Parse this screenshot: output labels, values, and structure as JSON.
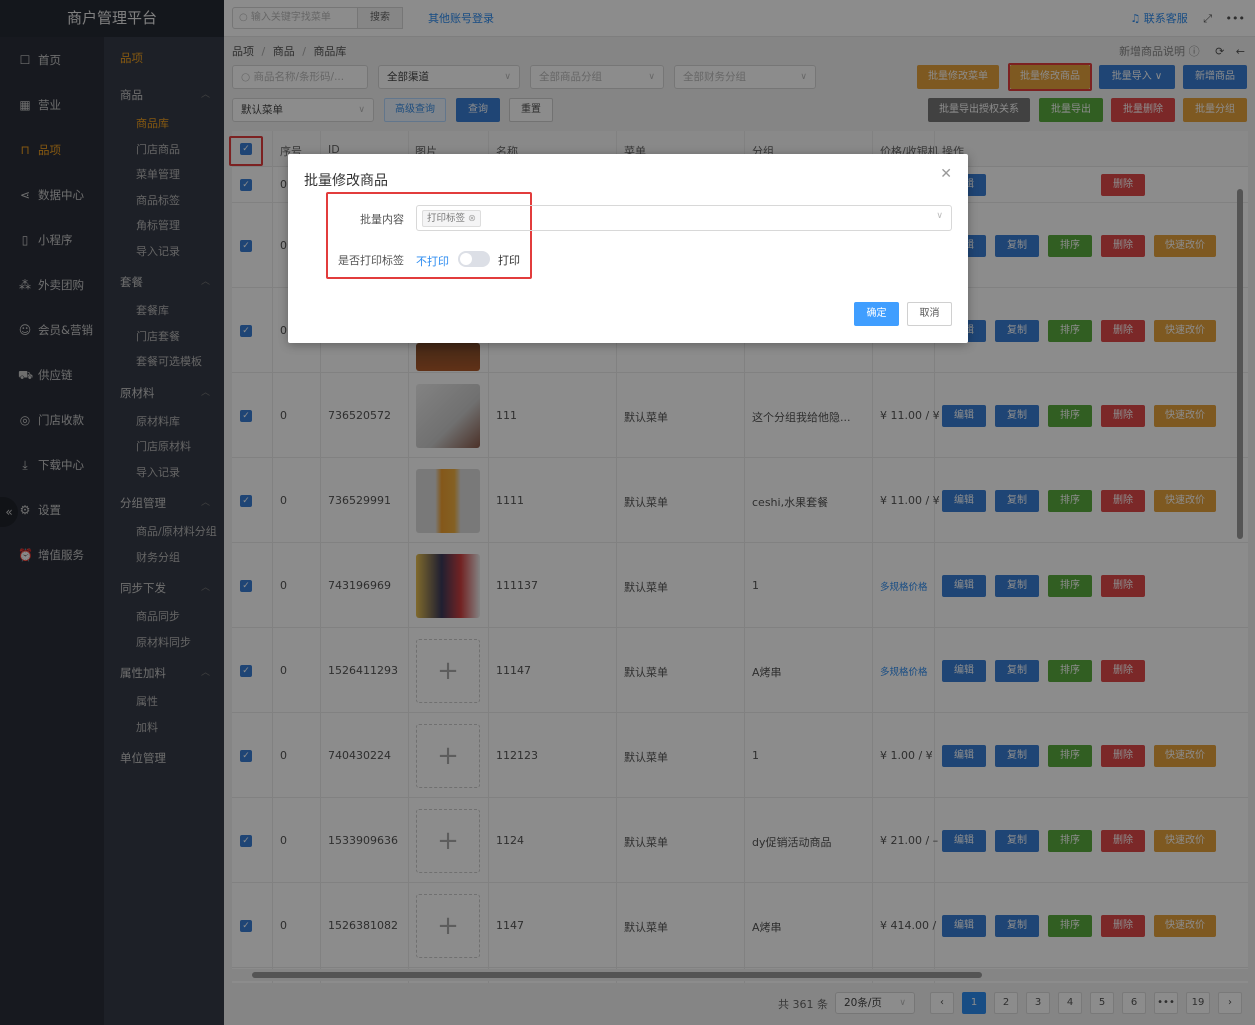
{
  "app": {
    "title": "商户管理平台"
  },
  "topbar": {
    "search_placeholder": "输入关键字找菜单",
    "search_btn": "搜索",
    "other_login": "其他账号登录",
    "support": "联系客服",
    "fullscreen_icon": "fullscreen-icon",
    "more_icon": "more-icon"
  },
  "sidebar": {
    "items": [
      {
        "label": "首页",
        "icon": "home-icon"
      },
      {
        "label": "营业",
        "icon": "calendar-icon"
      },
      {
        "label": "品项",
        "icon": "bag-icon"
      },
      {
        "label": "数据中心",
        "icon": "share-icon"
      },
      {
        "label": "小程序",
        "icon": "phone-icon"
      },
      {
        "label": "外卖团购",
        "icon": "group-icon"
      },
      {
        "label": "会员&营销",
        "icon": "user-icon"
      },
      {
        "label": "供应链",
        "icon": "truck-icon"
      },
      {
        "label": "门店收款",
        "icon": "coin-icon"
      },
      {
        "label": "下载中心",
        "icon": "download-icon"
      },
      {
        "label": "设置",
        "icon": "gear-icon"
      },
      {
        "label": "增值服务",
        "icon": "alarm-icon"
      }
    ]
  },
  "submenu": {
    "header": "品项",
    "groups": [
      {
        "label": "商品",
        "items": [
          "商品库",
          "门店商品",
          "菜单管理",
          "商品标签",
          "角标管理",
          "导入记录"
        ]
      },
      {
        "label": "套餐",
        "items": [
          "套餐库",
          "门店套餐",
          "套餐可选模板"
        ]
      },
      {
        "label": "原材料",
        "items": [
          "原材料库",
          "门店原材料",
          "导入记录"
        ]
      },
      {
        "label": "分组管理",
        "items": [
          "商品/原材料分组",
          "财务分组"
        ]
      },
      {
        "label": "同步下发",
        "items": [
          "商品同步",
          "原材料同步"
        ]
      },
      {
        "label": "属性加料",
        "items": [
          "属性",
          "加料"
        ]
      },
      {
        "label": "单位管理",
        "items": []
      }
    ]
  },
  "breadcrumb": {
    "a": "品项",
    "b": "商品",
    "c": "商品库",
    "sep": "/",
    "help": "新增商品说明"
  },
  "filters": {
    "name_placeholder": "商品名称/条形码/...",
    "channel": "全部渠道",
    "group": "全部商品分组",
    "finance": "全部财务分组",
    "menu": "默认菜单",
    "advanced": "高级查询",
    "query": "查询",
    "reset": "重置"
  },
  "actions": {
    "batch_menu": "批量修改菜单",
    "batch_goods": "批量修改商品",
    "batch_import": "批量导入",
    "add": "新增商品",
    "export_auth": "批量导出授权关系",
    "export": "批量导出",
    "batch_delete": "批量删除",
    "batch_group": "批量分组"
  },
  "table": {
    "headers": [
      "序号",
      "ID",
      "图片",
      "名称",
      "菜单",
      "分组",
      "价格/收银机",
      "操作"
    ],
    "btn": {
      "edit": "编辑",
      "copy": "复制",
      "sort": "排序",
      "del": "删除",
      "quick": "快速改价"
    },
    "rows": [
      {
        "seq": "0",
        "id": "",
        "name": "",
        "menu": "",
        "group": "",
        "price": "",
        "img": "none",
        "btns": [
          "edit",
          "del"
        ]
      },
      {
        "seq": "0",
        "id": "",
        "name": "",
        "menu": "",
        "group": "",
        "price": "",
        "img": "none",
        "btns": [
          "edit",
          "copy",
          "sort",
          "del",
          "quick"
        ]
      },
      {
        "seq": "0",
        "id": "",
        "name": "",
        "menu": "",
        "group": "",
        "price": "",
        "img": "bbq",
        "btns": [
          "edit",
          "copy",
          "sort",
          "del",
          "quick"
        ]
      },
      {
        "seq": "0",
        "id": "736520572",
        "name": "111",
        "menu": "默认菜单",
        "group": "这个分组我给他隐...",
        "price": "¥ 11.00 / ¥",
        "img": "paper",
        "btns": [
          "edit",
          "copy",
          "sort",
          "del",
          "quick"
        ]
      },
      {
        "seq": "0",
        "id": "736529991",
        "name": "1111",
        "menu": "默认菜单",
        "group": "ceshi,水果套餐",
        "price": "¥ 11.00 / ¥",
        "img": "bottle",
        "btns": [
          "edit",
          "copy",
          "sort",
          "del",
          "quick"
        ]
      },
      {
        "seq": "0",
        "id": "743196969",
        "name": "111137",
        "menu": "默认菜单",
        "group": "1",
        "price": "多规格价格",
        "img": "poster",
        "btns": [
          "edit",
          "copy",
          "sort",
          "del"
        ]
      },
      {
        "seq": "0",
        "id": "1526411293",
        "name": "11147",
        "menu": "默认菜单",
        "group": "A烤串",
        "price": "多规格价格",
        "img": "plus",
        "btns": [
          "edit",
          "copy",
          "sort",
          "del"
        ]
      },
      {
        "seq": "0",
        "id": "740430224",
        "name": "112123",
        "menu": "默认菜单",
        "group": "1",
        "price": "¥ 1.00 / ¥",
        "img": "plus",
        "btns": [
          "edit",
          "copy",
          "sort",
          "del",
          "quick"
        ]
      },
      {
        "seq": "0",
        "id": "1533909636",
        "name": "1124",
        "menu": "默认菜单",
        "group": "dy促销活动商品",
        "price": "¥ 21.00 / –",
        "img": "plus",
        "btns": [
          "edit",
          "copy",
          "sort",
          "del",
          "quick"
        ]
      },
      {
        "seq": "0",
        "id": "1526381082",
        "name": "1147",
        "menu": "默认菜单",
        "group": "A烤串",
        "price": "¥ 414.00 /",
        "img": "plus",
        "btns": [
          "edit",
          "copy",
          "sort",
          "del",
          "quick"
        ]
      }
    ]
  },
  "pager": {
    "total": "共 361 条",
    "size": "20条/页",
    "pages": [
      "1",
      "2",
      "3",
      "4",
      "5",
      "6",
      "•••",
      "19"
    ],
    "current": "1"
  },
  "modal": {
    "title": "批量修改商品",
    "content_label": "批量内容",
    "tag": "打印标签",
    "print_label": "是否打印标签",
    "off": "不打印",
    "on": "打印",
    "ok": "确定",
    "cancel": "取消",
    "switch_on": false
  },
  "colors": {
    "accent": "#f0a020",
    "primary": "#2d8cf0",
    "highlight": "#e23c3c"
  }
}
